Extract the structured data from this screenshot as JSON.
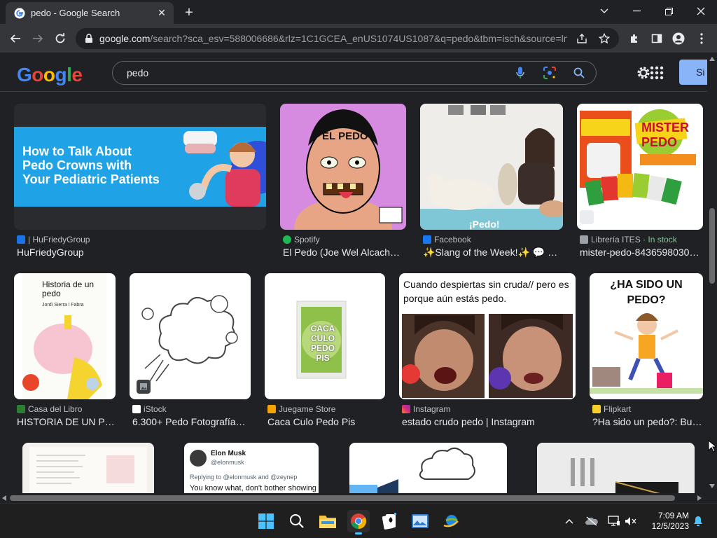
{
  "browser": {
    "tab_title": "pedo - Google Search",
    "url_host": "google.com",
    "url_rest": "/search?sca_esv=588006686&rlz=1C1GCEA_enUS1074US1087&q=pedo&tbm=isch&source=ln..."
  },
  "google": {
    "logo_letters": [
      "G",
      "o",
      "o",
      "g",
      "l",
      "e"
    ],
    "logo_colors": [
      "#4285f4",
      "#ea4335",
      "#fbbc05",
      "#4285f4",
      "#34a853",
      "#ea4335"
    ],
    "query": "pedo",
    "signin_label": "Si"
  },
  "results": [
    {
      "source": "| HuFriedyGroup",
      "title": "HuFriedyGroup",
      "thumb_text": "How to Talk About Pedo Crowns with Your Pediatric Patients",
      "fav_color": "#1a73e8"
    },
    {
      "source": "Spotify",
      "title": "El Pedo (Joe Wel Alcach…",
      "thumb_text": "EL PEDO",
      "fav_color": "#1db954"
    },
    {
      "source": "Facebook",
      "title": "✨Slang of the Week!✨ 💬 …",
      "thumb_text": "¡Pedo!",
      "fav_color": "#1877f2"
    },
    {
      "source": "Librería ITES",
      "stock": "· In stock",
      "title": "mister-pedo-8436598030…",
      "thumb_text": "MISTER PEDO",
      "fav_color": "#9aa0a6"
    },
    {
      "source": "Casa del Libro",
      "title": "HISTORIA DE UN P…",
      "thumb_text": "Historia de un pedo",
      "thumb_sub": "Jordi Sierra i Fabra",
      "fav_color": "#2e7d32"
    },
    {
      "source": "iStock",
      "title": "6.300+ Pedo Fotografía…",
      "fav_color": "#ffffff"
    },
    {
      "source": "Juegame Store",
      "title": "Caca Culo Pedo Pis",
      "thumb_text": "CACA CULO PEDO PIS",
      "fav_color": "#f4a300"
    },
    {
      "source": "Instagram",
      "title": "estado crudo pedo | Instagram",
      "thumb_text": "Cuando despiertas sin cruda// pero es porque aún estás pedo.",
      "fav_color": "#e1306c"
    },
    {
      "source": "Flipkart",
      "title": "?Ha sido un pedo?: Bu…",
      "thumb_text": "¿HA SIDO UN PEDO?",
      "fav_color": "#f7d02c"
    },
    {
      "thumb_text": "Elon Musk",
      "thumb_sub": "@elonmusk",
      "thumb_reply": "Replying to @elonmusk and @zeynep",
      "thumb_body": "You know what, don't bother showing"
    }
  ],
  "taskbar": {
    "time": "7:09 AM",
    "date": "12/5/2023"
  }
}
